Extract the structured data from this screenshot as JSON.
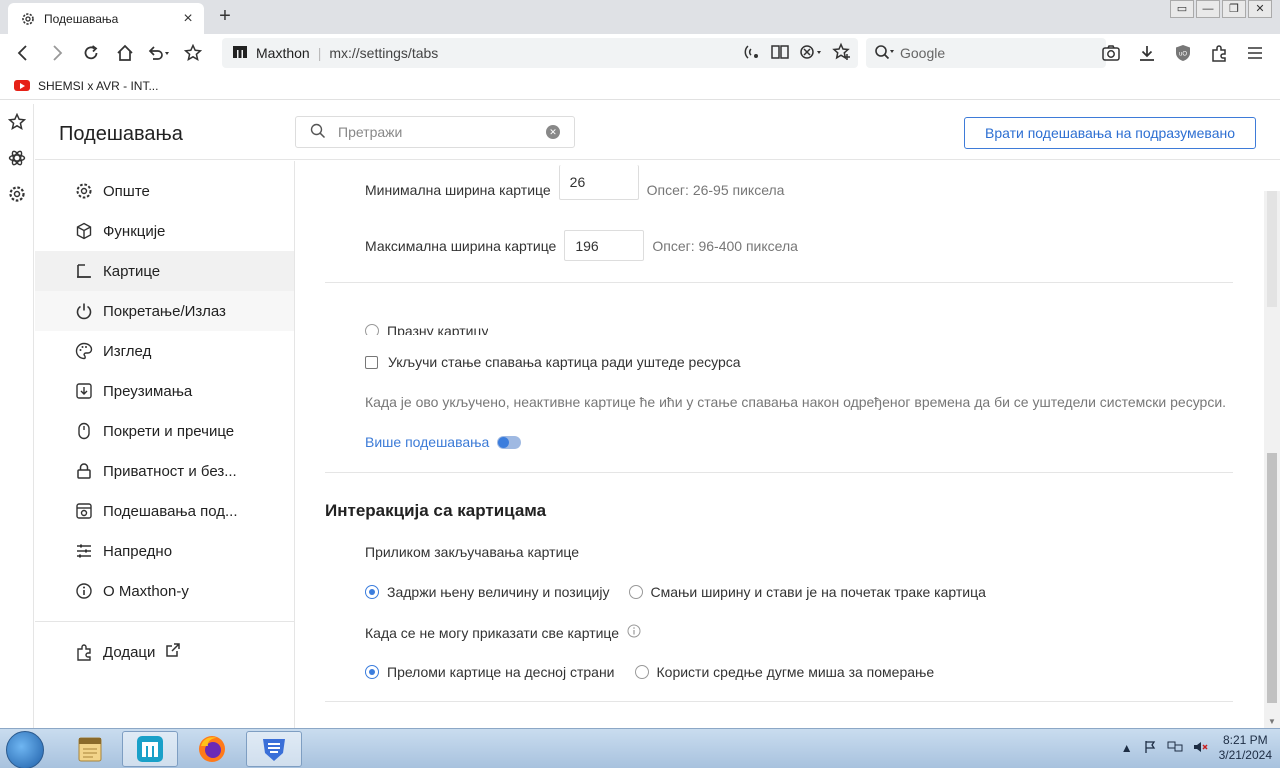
{
  "browser": {
    "tab_title": "Подешавања",
    "new_tab": "+",
    "window_controls": [
      "▭",
      "—",
      "❐",
      "✕"
    ],
    "site_name": "Maxthon",
    "url": "mx://settings/tabs",
    "search_engine": "Google",
    "bookmark": "SHEMSI x AVR - INT..."
  },
  "settings": {
    "title": "Подешавања",
    "search_placeholder": "Претражи",
    "reset_button": "Врати подешавања на подразумевано"
  },
  "nav": [
    {
      "label": "Опште",
      "icon": "gear-icon"
    },
    {
      "label": "Функције",
      "icon": "cube-icon"
    },
    {
      "label": "Картице",
      "icon": "tab-icon"
    },
    {
      "label": "Покретање/Излаз",
      "icon": "power-icon"
    },
    {
      "label": "Изглед",
      "icon": "palette-icon"
    },
    {
      "label": "Преузимања",
      "icon": "download-icon"
    },
    {
      "label": "Покрети и пречице",
      "icon": "mouse-icon"
    },
    {
      "label": "Приватност и без...",
      "icon": "lock-icon"
    },
    {
      "label": "Подешавања под...",
      "icon": "site-settings-icon"
    },
    {
      "label": "Напредно",
      "icon": "sliders-icon"
    },
    {
      "label": "О Maxthon-у",
      "icon": "info-icon"
    }
  ],
  "addons": "Додаци",
  "content": {
    "min_width_label": "Минимална ширина картице",
    "min_width_value": "26",
    "min_width_hint": "Опсег: 26-95 пиксела",
    "max_width_label": "Максимална ширина картице",
    "max_width_value": "196",
    "max_width_hint": "Опсег: 96-400 пиксела",
    "partial_radio": "Празну картицу",
    "sleep_checkbox": "Укључи стање спавања картица ради уштеде ресурса",
    "sleep_desc": "Када је ово укључено, неактивне картице ће ићи у стање спавања након одређеног времена да би се уштедели системски ресурси.",
    "more_settings": "Више подешавања",
    "section_title": "Интеракција са картицама",
    "lock_label": "Приликом закључавања картице",
    "lock_opt1": "Задржи њену величину и позицију",
    "lock_opt2": "Смањи ширину и стави је на почетак траке картица",
    "overflow_label": "Када се не могу приказати све картице",
    "overflow_opt1": "Преломи картице на десној страни",
    "overflow_opt2": "Користи средње дугме миша за померање"
  },
  "taskbar": {
    "time": "8:21 PM",
    "date": "3/21/2024"
  },
  "colors": {
    "accent": "#3b7ddd",
    "reset_border": "#3e7bd8"
  }
}
